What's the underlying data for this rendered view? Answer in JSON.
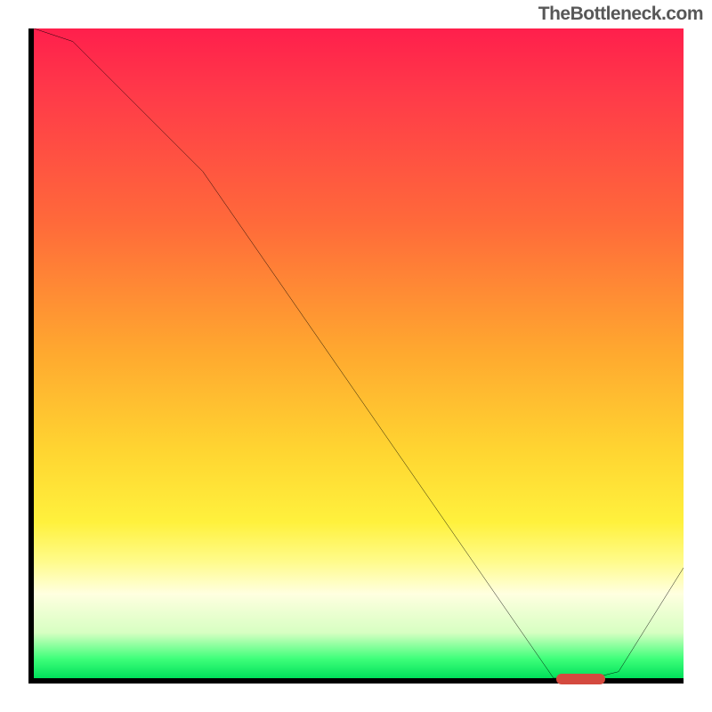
{
  "attribution": "TheBottleneck.com",
  "chart_data": {
    "type": "line",
    "title": "",
    "xlabel": "",
    "ylabel": "",
    "xlim": [
      0,
      100
    ],
    "ylim": [
      0,
      100
    ],
    "series": [
      {
        "name": "curve",
        "x": [
          0,
          6,
          26,
          80,
          86,
          90,
          100
        ],
        "y": [
          100,
          98,
          78,
          0,
          0,
          1,
          17
        ]
      }
    ],
    "marker": {
      "x_start": 80,
      "x_end": 87,
      "y": 0
    },
    "background": "vertical gradient red→orange→yellow→pale→green",
    "legend": null,
    "grid": false
  }
}
